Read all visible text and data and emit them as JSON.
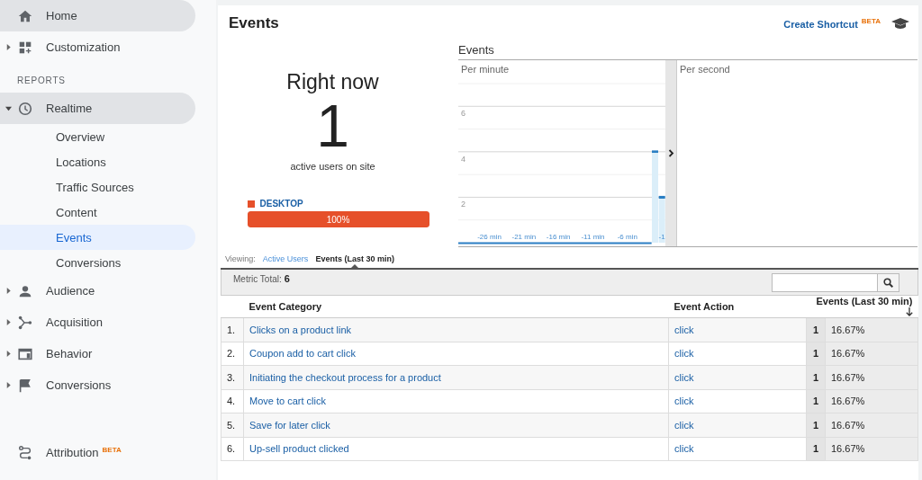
{
  "sidebar": {
    "items": [
      {
        "label": "Home",
        "selected": true
      },
      {
        "label": "Customization",
        "selected": false,
        "expanded": false
      },
      {
        "kind": "heading",
        "label": "REPORTS"
      },
      {
        "label": "Realtime",
        "selected": true,
        "expanded": true,
        "children": [
          {
            "label": "Overview",
            "selected": false
          },
          {
            "label": "Locations",
            "selected": false
          },
          {
            "label": "Traffic Sources",
            "selected": false
          },
          {
            "label": "Content",
            "selected": false
          },
          {
            "label": "Events",
            "selected": true
          },
          {
            "label": "Conversions",
            "selected": false
          }
        ]
      },
      {
        "label": "Audience",
        "selected": false,
        "expanded": false
      },
      {
        "label": "Acquisition",
        "selected": false,
        "expanded": false
      },
      {
        "label": "Behavior",
        "selected": false,
        "expanded": false
      },
      {
        "label": "Conversions",
        "selected": false,
        "expanded": false
      },
      {
        "kind": "spacer"
      },
      {
        "label": "Attribution",
        "selected": false,
        "badge": "BETA"
      }
    ]
  },
  "page": {
    "title": "Events",
    "shortcut": {
      "label": "Create Shortcut",
      "badge": "BETA"
    }
  },
  "right_now": {
    "heading": "Right now",
    "count": "1",
    "caption": "active users on site",
    "devices": [
      {
        "label": "DESKTOP",
        "color": "#e6502a",
        "level": 1.0,
        "reading": "100%"
      }
    ]
  },
  "events_chart": {
    "title": "Events",
    "per_minute": {
      "label": "Per minute",
      "chart_data": {
        "type": "bar",
        "x": [
          -30,
          -29,
          -28,
          -27,
          -26,
          -25,
          -24,
          -23,
          -22,
          -21,
          -20,
          -19,
          -18,
          -17,
          -16,
          -15,
          -14,
          -13,
          -12,
          -11,
          -10,
          -9,
          -8,
          -7,
          -6,
          -5,
          -4,
          -3,
          -2,
          -1
        ],
        "values": [
          0,
          0,
          0,
          0,
          0,
          0,
          0,
          0,
          0,
          0,
          0,
          0,
          0,
          0,
          0,
          0,
          0,
          0,
          0,
          0,
          0,
          0,
          0,
          0,
          0,
          0,
          0,
          0,
          4,
          2
        ],
        "xlim": [
          -30.5,
          -0.5
        ],
        "ylim": [
          0,
          7
        ],
        "yticks": [
          2,
          4,
          6
        ],
        "grid": true,
        "xticks": [
          {
            "value": -26,
            "label": "-26 min"
          },
          {
            "value": -21,
            "label": "-21 min"
          },
          {
            "value": -16,
            "label": "-16 min"
          },
          {
            "value": -11,
            "label": "-11 min"
          },
          {
            "value": -6,
            "label": "-6 min"
          },
          {
            "value": -1,
            "label": "-1"
          }
        ]
      }
    },
    "per_second": {
      "label": "Per second"
    }
  },
  "viewing": {
    "label": "Viewing:",
    "tabs": [
      {
        "label": "Active Users",
        "selected": false
      },
      {
        "label": "Events (Last 30 min)",
        "selected": true
      }
    ]
  },
  "table": {
    "metric_total": {
      "label": "Metric Total:",
      "value": "6"
    },
    "columns": [
      "Event Category",
      "Event Action",
      "Events (Last 30 min)"
    ],
    "rows": [
      {
        "index": "1.",
        "category": "Clicks on a product link",
        "action": "click",
        "events": "1",
        "share": "16.67%"
      },
      {
        "index": "2.",
        "category": "Coupon add to cart click",
        "action": "click",
        "events": "1",
        "share": "16.67%"
      },
      {
        "index": "3.",
        "category": "Initiating the checkout process for a product",
        "action": "click",
        "events": "1",
        "share": "16.67%"
      },
      {
        "index": "4.",
        "category": "Move to cart click",
        "action": "click",
        "events": "1",
        "share": "16.67%"
      },
      {
        "index": "5.",
        "category": "Save for later click",
        "action": "click",
        "events": "1",
        "share": "16.67%"
      },
      {
        "index": "6.",
        "category": "Up-sell product clicked",
        "action": "click",
        "events": "1",
        "share": "16.67%"
      }
    ]
  }
}
